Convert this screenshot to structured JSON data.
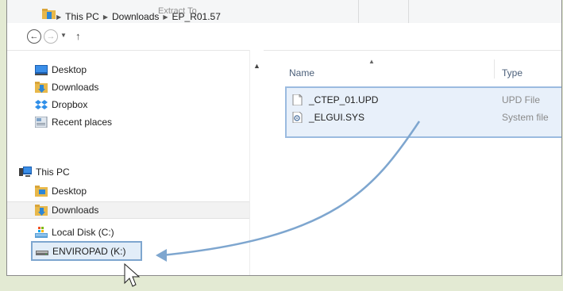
{
  "ribbon": {
    "label": "Extract To"
  },
  "nav": {
    "back_icon": "arrow-left-icon",
    "forward_icon": "arrow-right-icon",
    "recent_icon": "chevron-down-icon",
    "up_icon": "arrow-up-icon",
    "up_glyph": "↑",
    "breadcrumbs": [
      "This PC",
      "Downloads",
      "EP_R01.57"
    ]
  },
  "sidebar": {
    "favorites": [
      {
        "label": "Desktop",
        "icon": "desktop-icon"
      },
      {
        "label": "Downloads",
        "icon": "downloads-folder-icon"
      },
      {
        "label": "Dropbox",
        "icon": "dropbox-icon"
      },
      {
        "label": "Recent places",
        "icon": "recent-places-icon"
      }
    ],
    "this_pc": {
      "label": "This PC",
      "icon": "computer-icon"
    },
    "pc_items": [
      {
        "label": "Desktop",
        "icon": "desktop-folder-icon"
      },
      {
        "label": "Downloads",
        "icon": "downloads-folder-icon"
      }
    ],
    "drives": [
      {
        "label": "Local Disk (C:)",
        "icon": "local-disk-icon"
      },
      {
        "label": "ENVIROPAD (K:)",
        "icon": "removable-drive-icon"
      }
    ]
  },
  "file_list": {
    "columns": [
      "Name",
      "Type"
    ],
    "files": [
      {
        "name": "_CTEP_01.UPD",
        "type": "UPD File",
        "icon": "blank-file-icon"
      },
      {
        "name": "_ELGUI.SYS",
        "type": "System file",
        "icon": "system-file-icon"
      }
    ]
  },
  "colors": {
    "background": "#e3ead3",
    "selection_border": "#7ea6cf",
    "arrow": "#7ea6cf"
  }
}
